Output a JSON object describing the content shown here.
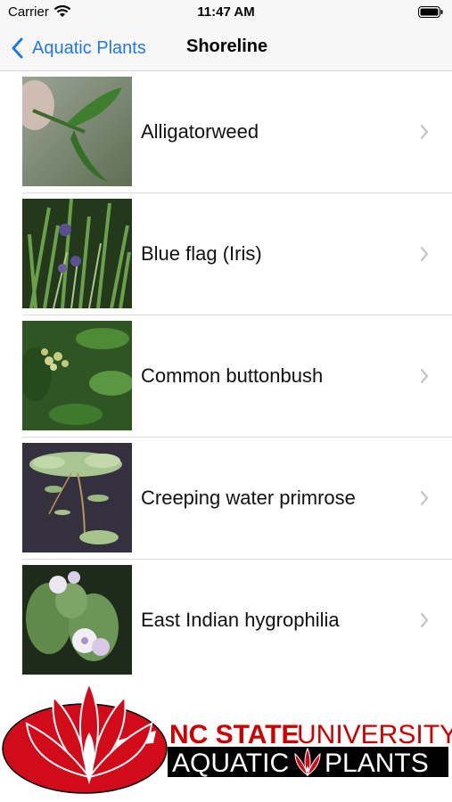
{
  "status": {
    "carrier": "Carrier",
    "time": "11:47 AM"
  },
  "nav": {
    "back_label": "Aquatic Plants",
    "title": "Shoreline"
  },
  "plants": [
    {
      "name": "Alligatorweed",
      "icon": "chevron-right-icon"
    },
    {
      "name": "Blue flag (Iris)",
      "icon": "chevron-right-icon"
    },
    {
      "name": "Common buttonbush",
      "icon": "chevron-right-icon"
    },
    {
      "name": "Creeping water primrose",
      "icon": "chevron-right-icon"
    },
    {
      "name": "East Indian hygrophilia",
      "icon": "chevron-right-icon"
    }
  ],
  "logo": {
    "line1_bold": "NC STATE",
    "line1_light": "UNIVERSITY",
    "line2_left": "AQUATIC",
    "line2_right": "PLANTS"
  },
  "colors": {
    "accent": "#1f7ae0",
    "brand_red": "#cc0000",
    "separator": "#dadada",
    "bar_background": "#f7f7f7"
  }
}
